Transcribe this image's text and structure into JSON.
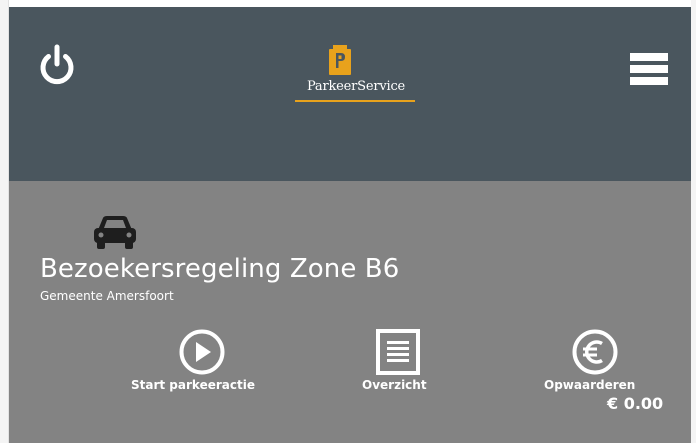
{
  "header": {
    "logo_text": "ParkeerService",
    "power_icon": "power-icon",
    "menu_icon": "hamburger-menu-icon",
    "background_color": "#4a565e",
    "logo_accent_color": "#e8a21c"
  },
  "permit": {
    "icon": "car-icon",
    "title": "Bezoekersregeling Zone B6",
    "municipality": "Gemeente Amersfoort",
    "background_color": "#838383"
  },
  "actions": [
    {
      "label": "Start parkeeractie",
      "icon": "play-circle-icon"
    },
    {
      "label": "Overzicht",
      "icon": "list-document-icon"
    },
    {
      "label": "Opwaarderen",
      "icon": "euro-circle-icon"
    }
  ],
  "balance": "€ 0.00"
}
